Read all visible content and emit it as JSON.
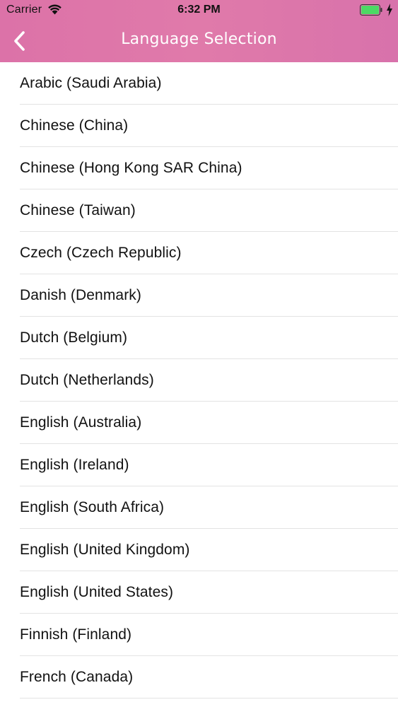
{
  "status_bar": {
    "carrier": "Carrier",
    "time": "6:32 PM",
    "battery_color": "#4cd964"
  },
  "nav": {
    "title": "Language Selection",
    "back_icon": "chevron-left-icon",
    "background": "#dc72a8"
  },
  "languages": [
    "Arabic (Saudi Arabia)",
    "Chinese (China)",
    "Chinese (Hong Kong SAR China)",
    "Chinese (Taiwan)",
    "Czech (Czech Republic)",
    "Danish (Denmark)",
    "Dutch (Belgium)",
    "Dutch (Netherlands)",
    "English (Australia)",
    "English (Ireland)",
    "English (South Africa)",
    "English (United Kingdom)",
    "English (United States)",
    "Finnish (Finland)",
    "French (Canada)"
  ]
}
